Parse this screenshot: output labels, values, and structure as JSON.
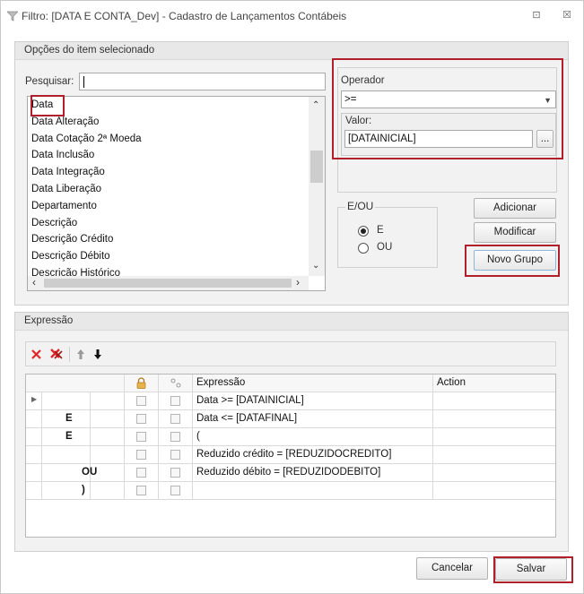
{
  "window": {
    "title": "Filtro: [DATA E CONTA_Dev] - Cadastro de Lançamentos Contábeis",
    "restore_glyph": "⊡",
    "close_glyph": "☒"
  },
  "options_panel": {
    "header": "Opções do item selecionado",
    "search_label": "Pesquisar:",
    "search_value": "",
    "fields": [
      "Data",
      "Data Alteração",
      "Data Cotação 2ª Moeda",
      "Data Inclusão",
      "Data Integração",
      "Data Liberação",
      "Departamento",
      "Descrição",
      "Descrição Crédito",
      "Descrição Débito",
      "Descrição Histórico"
    ],
    "selected_field": "Data",
    "operator_label": "Operador",
    "operator_value": ">=",
    "valor_label": "Valor:",
    "valor_value": "[DATAINICIAL]",
    "browse_label": "...",
    "eou_label": "E/OU",
    "radio_e": "E",
    "radio_ou": "OU",
    "radio_selected": "E",
    "btn_adicionar": "Adicionar",
    "btn_modificar": "Modificar",
    "btn_novo_grupo": "Novo Grupo"
  },
  "expression_panel": {
    "header": "Expressão",
    "columns": {
      "expressao": "Expressão",
      "action": "Action"
    },
    "rows": [
      {
        "logic": "",
        "logic2": "",
        "expr": "Data >= [DATAINICIAL]"
      },
      {
        "logic": "E",
        "logic2": "",
        "expr": "Data <= [DATAFINAL]"
      },
      {
        "logic": "E",
        "logic2": "",
        "expr": "("
      },
      {
        "logic": "",
        "logic2": "",
        "expr": "Reduzido crédito = [REDUZIDOCREDITO]"
      },
      {
        "logic": "",
        "logic2": "OU",
        "expr": "Reduzido débito = [REDUZIDODEBITO]"
      },
      {
        "logic": "",
        "logic2": ")",
        "expr": ""
      }
    ]
  },
  "footer": {
    "cancel_label": "Cancelar",
    "save_label": "Salvar"
  },
  "colors": {
    "highlight_box": "#b0202a",
    "delete_icon": "#e0262a"
  }
}
